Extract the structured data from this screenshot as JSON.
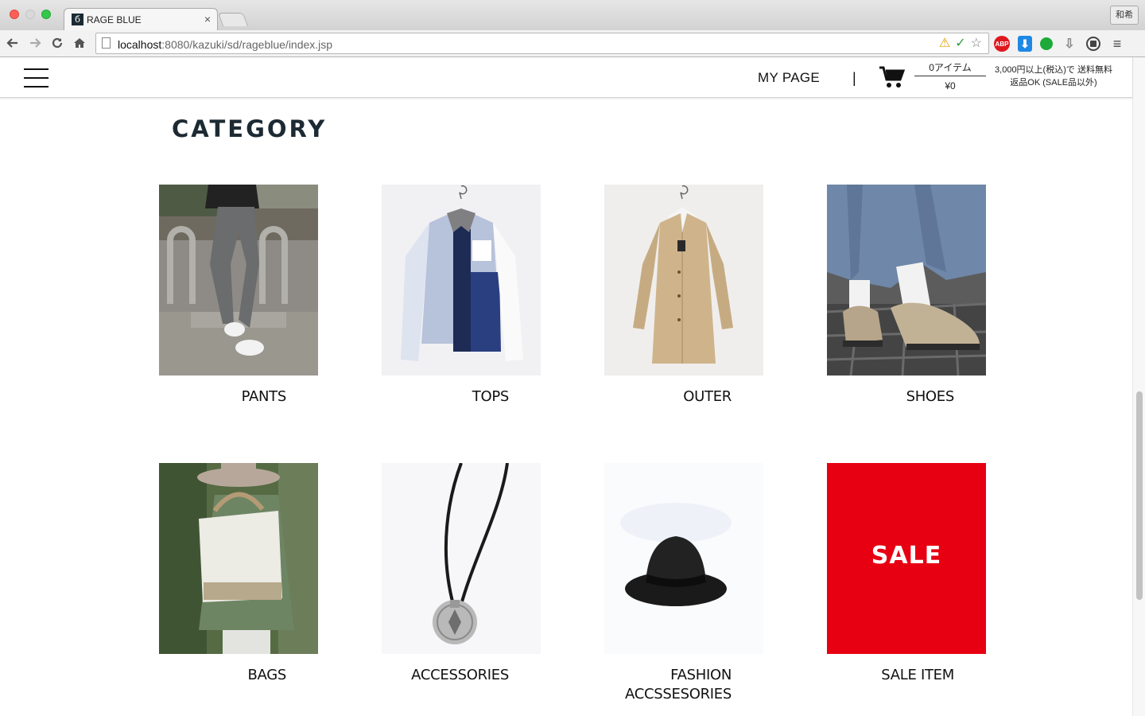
{
  "browser": {
    "tab_title": "RAGE BLUE",
    "tab_favicon": "б",
    "tab_close": "×",
    "profile_label": "和希",
    "url_host": "localhost",
    "url_path": ":8080/kazuki/sd/rageblue/index.jsp"
  },
  "header": {
    "my_page": "MY PAGE",
    "divider": "|",
    "cart_count": "0アイテム",
    "cart_total": "¥0",
    "shipping_line1": "3,000円以上(税込)で 送料無料",
    "shipping_line2": "返品OK (SALE品以外)"
  },
  "content": {
    "section_title": "CATEGORY",
    "categories": [
      {
        "label": "PANTS"
      },
      {
        "label": "TOPS"
      },
      {
        "label": "OUTER"
      },
      {
        "label": "SHOES"
      },
      {
        "label": "BAGS"
      },
      {
        "label": "ACCESSORIES"
      },
      {
        "label": "FASHION",
        "label2": "ACCSSESORIES"
      },
      {
        "label": "SALE ITEM"
      }
    ],
    "sale_banner_text": "SALE"
  },
  "colors": {
    "sale_red": "#e60012",
    "title_color": "#1c2a33"
  }
}
